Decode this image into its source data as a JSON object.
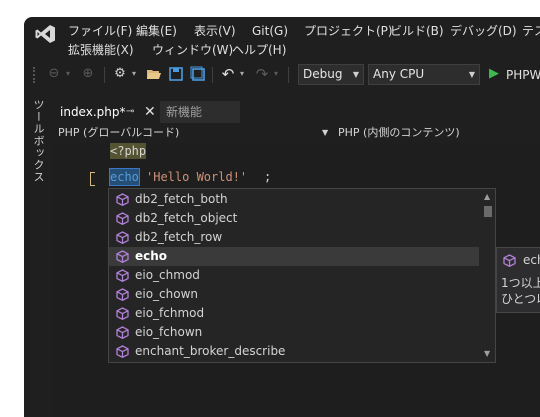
{
  "menu": {
    "row1": [
      "ファイル(F)",
      "編集(E)",
      "表示(V)",
      "Git(G)",
      "プロジェクト(P)",
      "ビルド(B)",
      "デバッグ(D)",
      "テス"
    ],
    "row2": [
      "拡張機能(X)",
      "ウィンドウ(W)",
      "ヘルプ(H)"
    ]
  },
  "toolbar": {
    "config": "Debug",
    "platform": "Any CPU",
    "run_label": "PHPW"
  },
  "toolbox": {
    "label": "ツールボックス"
  },
  "tabs": [
    {
      "label": "index.php*",
      "active": true
    },
    {
      "label": "新機能",
      "active": false
    }
  ],
  "navbar": {
    "scope": "PHP (グローバルコード)",
    "member": "PHP (内側のコンテンツ)"
  },
  "code": {
    "line1": "<?php",
    "line2_keyword": "echo",
    "line2_string": "'Hello World!'",
    "line2_end": ";"
  },
  "completion": {
    "items": [
      "db2_fetch_both",
      "db2_fetch_object",
      "db2_fetch_row",
      "echo",
      "eio_chmod",
      "eio_chown",
      "eio_fchmod",
      "eio_fchown",
      "enchant_broker_describe"
    ],
    "selected": "echo"
  },
  "tooltip": {
    "title": "ech",
    "line1": "1つ以上",
    "line2": "ひとつ以"
  },
  "colors": {
    "accent": "#8a6dd6",
    "keyword": "#569cd6",
    "string": "#ce9178",
    "php_tag_bg": "#545433",
    "cube": "#b180d7"
  }
}
